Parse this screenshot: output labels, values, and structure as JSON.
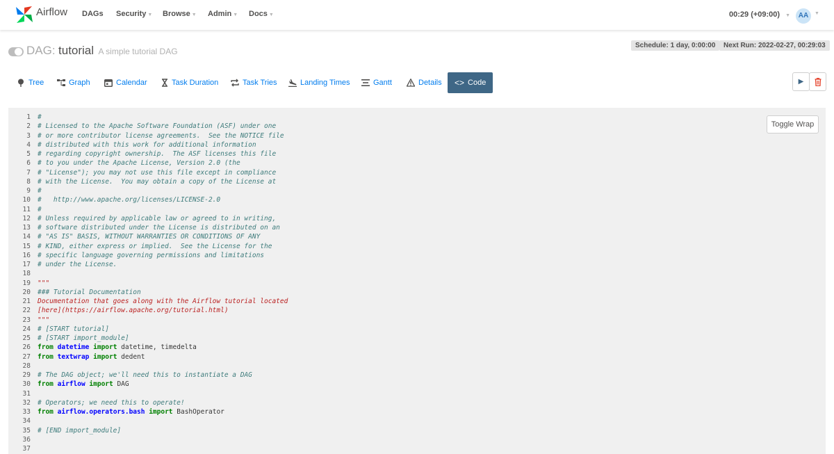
{
  "nav": {
    "brand": "Airflow",
    "items": [
      "DAGs",
      "Security",
      "Browse",
      "Admin",
      "Docs"
    ],
    "clock": "00:29 (+09:00)",
    "avatar": "AA"
  },
  "header": {
    "dag_label": "DAG:",
    "dag_id": "tutorial",
    "dag_description": "A simple tutorial DAG",
    "schedule": "Schedule: 1 day, 0:00:00",
    "next_run": "Next Run: 2022-02-27, 00:29:03"
  },
  "tabs": [
    "Tree",
    "Graph",
    "Calendar",
    "Task Duration",
    "Task Tries",
    "Landing Times",
    "Gantt",
    "Details",
    "Code"
  ],
  "actions": {
    "trigger_icon": "play-icon",
    "delete_icon": "trash-icon"
  },
  "code": {
    "toggle_wrap": "Toggle Wrap",
    "line_numbers": [
      "1",
      "2",
      "3",
      "4",
      "5",
      "6",
      "7",
      "8",
      "9",
      "10",
      "11",
      "12",
      "13",
      "14",
      "15",
      "16",
      "17",
      "18",
      "19",
      "20",
      "21",
      "22",
      "23",
      "24",
      "25",
      "26",
      "27",
      "28",
      "29",
      "30",
      "31",
      "32",
      "33",
      "34",
      "35",
      "36",
      "37"
    ],
    "lines": [
      "#",
      "# Licensed to the Apache Software Foundation (ASF) under one",
      "# or more contributor license agreements.  See the NOTICE file",
      "# distributed with this work for additional information",
      "# regarding copyright ownership.  The ASF licenses this file",
      "# to you under the Apache License, Version 2.0 (the",
      "# \"License\"); you may not use this file except in compliance",
      "# with the License.  You may obtain a copy of the License at",
      "#",
      "#   http://www.apache.org/licenses/LICENSE-2.0",
      "#",
      "# Unless required by applicable law or agreed to in writing,",
      "# software distributed under the License is distributed on an",
      "# \"AS IS\" BASIS, WITHOUT WARRANTIES OR CONDITIONS OF ANY",
      "# KIND, either express or implied.  See the License for the",
      "# specific language governing permissions and limitations",
      "# under the License.",
      "",
      "\"\"\"",
      "### Tutorial Documentation",
      "Documentation that goes along with the Airflow tutorial located",
      "[here](https://airflow.apache.org/tutorial.html)",
      "\"\"\"",
      "# [START tutorial]",
      "# [START import_module]",
      "from datetime import datetime, timedelta",
      "from textwrap import dedent",
      "",
      "# The DAG object; we'll need this to instantiate a DAG",
      "from airflow import DAG",
      "",
      "# Operators; we need this to operate!",
      "from airflow.operators.bash import BashOperator",
      "",
      "# [END import_module]",
      "",
      ""
    ]
  }
}
